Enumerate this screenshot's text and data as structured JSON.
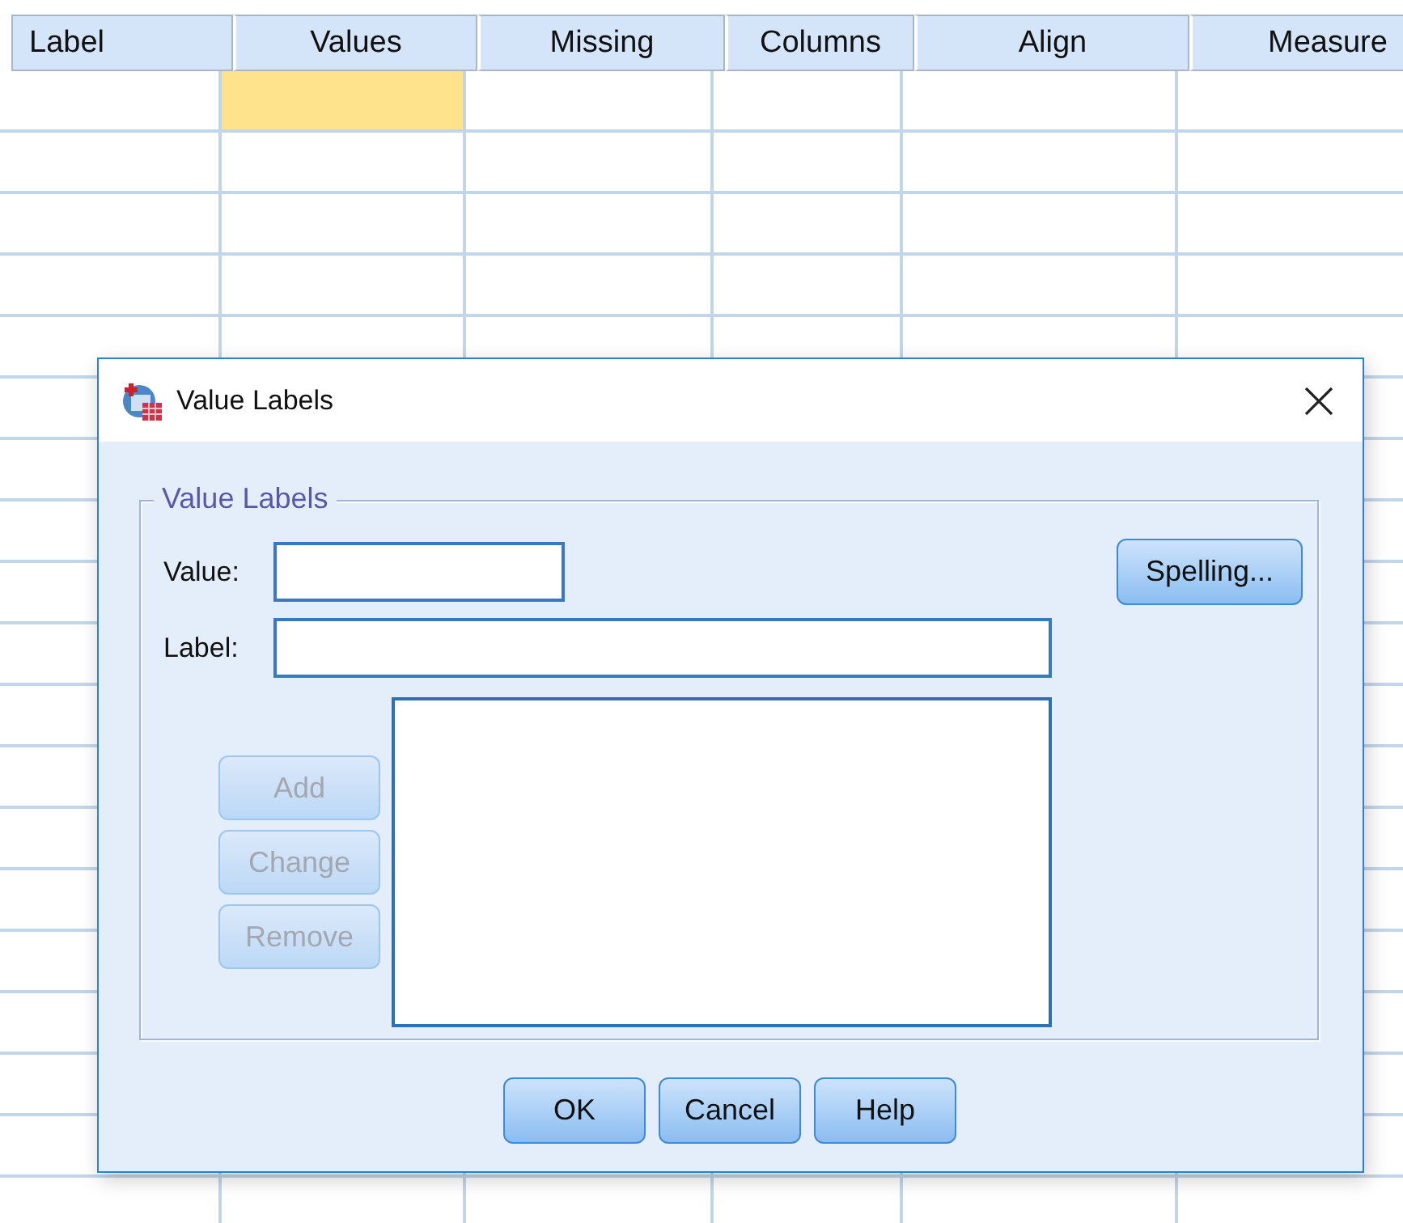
{
  "grid": {
    "columns": [
      "Label",
      "Values",
      "Missing",
      "Columns",
      "Align",
      "Measure"
    ],
    "rows": [
      {
        "cells": [
          {
            "selected": false
          },
          {
            "selected": true
          },
          {
            "selected": false
          },
          {
            "selected": false
          },
          {
            "selected": false
          },
          {
            "selected": false
          }
        ]
      }
    ]
  },
  "dialog": {
    "title": "Value Labels",
    "group": {
      "title": "Value Labels",
      "value_field": {
        "label": "Value:"
      },
      "label_field": {
        "label": "Label:"
      },
      "side_buttons": [
        {
          "label": "Add",
          "disabled": true
        },
        {
          "label": "Change",
          "disabled": true
        },
        {
          "label": "Remove",
          "disabled": true
        }
      ],
      "spelling_button": {
        "label": "Spelling...",
        "disabled": false
      }
    },
    "buttons": [
      {
        "label": "OK",
        "disabled": false
      },
      {
        "label": "Cancel",
        "disabled": false
      },
      {
        "label": "Help",
        "disabled": false
      }
    ]
  }
}
